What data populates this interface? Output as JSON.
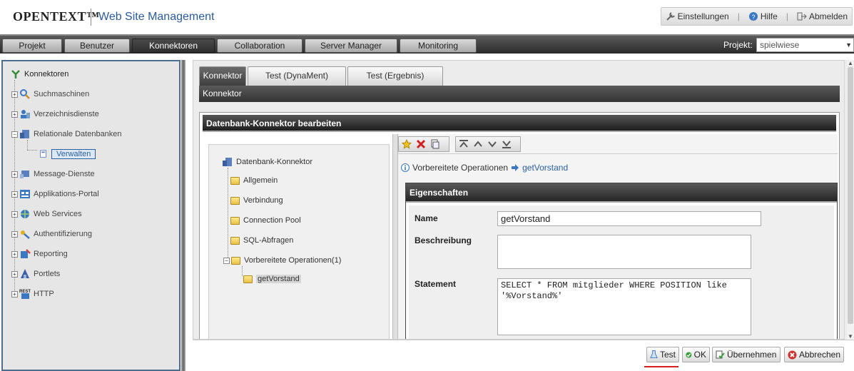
{
  "header": {
    "logo": "OPENTEXT™",
    "app_title": "Web Site Management",
    "links": {
      "settings": "Einstellungen",
      "help": "Hilfe",
      "logout": "Abmelden"
    }
  },
  "tabs": [
    "Projekt",
    "Benutzer",
    "Konnektoren",
    "Collaboration",
    "Server Manager",
    "Monitoring"
  ],
  "active_tab": "Konnektoren",
  "project": {
    "label": "Projekt:",
    "value": "spielwiese"
  },
  "sidebar": {
    "root": "Konnektoren",
    "items": [
      {
        "label": "Suchmaschinen"
      },
      {
        "label": "Verzeichnisdienste"
      },
      {
        "label": "Relationale Datenbanken"
      },
      {
        "label": "Verwalten"
      },
      {
        "label": "Message-Dienste"
      },
      {
        "label": "Applikations-Portal"
      },
      {
        "label": "Web Services"
      },
      {
        "label": "Authentifizierung"
      },
      {
        "label": "Reporting"
      },
      {
        "label": "Portlets"
      },
      {
        "label": "HTTP"
      }
    ]
  },
  "subtabs": [
    "Konnektor",
    "Test (DynaMent)",
    "Test (Ergebnis)"
  ],
  "section_title": "Konnektor",
  "editor": {
    "title": "Datenbank-Konnektor bearbeiten",
    "tree": {
      "root": "Datenbank-Konnektor",
      "items": [
        "Allgemein",
        "Verbindung",
        "Connection Pool",
        "SQL-Abfragen",
        "Vorbereitete Operationen(1)",
        "getVorstand"
      ]
    },
    "breadcrumb": {
      "parent": "Vorbereitete Operationen",
      "current": "getVorstand"
    },
    "properties": {
      "title": "Eigenschaften",
      "name_label": "Name",
      "name_value": "getVorstand",
      "description_label": "Beschreibung",
      "description_value": "",
      "statement_label": "Statement",
      "statement_value": "SELECT * FROM mitglieder WHERE POSITION like '%Vorstand%'"
    }
  },
  "footer": {
    "test": "Test",
    "ok": "OK",
    "apply": "Übernehmen",
    "cancel": "Abbrechen"
  },
  "colors": {
    "accent": "#2b5f9e",
    "dark_bar": "#333333",
    "underline": "#d42020"
  }
}
